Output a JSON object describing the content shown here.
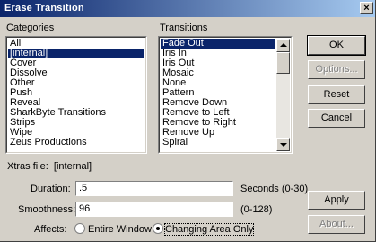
{
  "window": {
    "title": "Erase Transition",
    "close_glyph": "×"
  },
  "categories": {
    "label": "Categories",
    "items": [
      "All",
      "[internal]",
      "Cover",
      "Dissolve",
      "Other",
      "Push",
      "Reveal",
      "SharkByte Transitions",
      "Strips",
      "Wipe",
      "Zeus Productions"
    ],
    "selected": "[internal]"
  },
  "transitions": {
    "label": "Transitions",
    "items": [
      "Fade Out",
      "Iris In",
      "Iris Out",
      "Mosaic",
      "None",
      "Pattern",
      "Remove Down",
      "Remove to Left",
      "Remove to Right",
      "Remove Up",
      "Spiral"
    ],
    "selected": "Fade Out"
  },
  "xtras": {
    "label": "Xtras file:",
    "value": "[internal]"
  },
  "duration": {
    "label": "Duration:",
    "value": ".5",
    "hint": "Seconds (0-30)"
  },
  "smoothness": {
    "label": "Smoothness:",
    "value": "96",
    "hint": "(0-128)"
  },
  "affects": {
    "label": "Affects:",
    "options": [
      "Entire Window",
      "Changing Area Only"
    ],
    "selected": "Changing Area Only"
  },
  "buttons": {
    "ok": "OK",
    "options": "Options...",
    "reset": "Reset",
    "cancel": "Cancel",
    "apply": "Apply",
    "about": "About..."
  },
  "colors": {
    "titlebar_start": "#0a246a",
    "titlebar_end": "#a6caf0",
    "selection": "#0a246a",
    "face": "#d4d0c8"
  }
}
